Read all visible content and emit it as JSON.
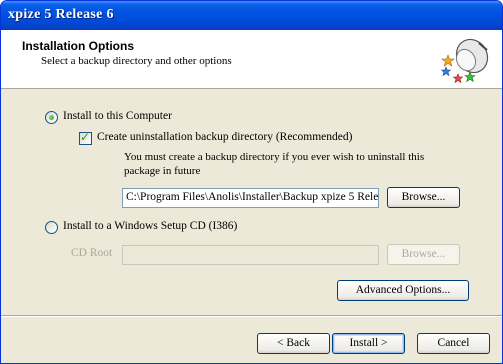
{
  "window": {
    "title": "xpize 5 Release 6"
  },
  "header": {
    "title": "Installation Options",
    "subtitle": "Select a backup directory and other options",
    "icon": "installer-disk-stars-icon"
  },
  "options": {
    "install_computer_label": "Install to this Computer",
    "install_computer_selected": true,
    "backup_checkbox_label": "Create uninstallation backup directory (Recommended)",
    "backup_checkbox_checked": true,
    "backup_note_line1": "You must create a backup directory if you ever wish to uninstall this",
    "backup_note_line2": "package in future",
    "backup_path": "C:\\Program Files\\Anolis\\Installer\\Backup xpize 5 Rele",
    "browse_label": "Browse...",
    "install_cd_label": "Install to a Windows Setup CD (I386)",
    "install_cd_selected": false,
    "cd_root_label": "CD Root",
    "cd_root_value": "",
    "cd_browse_label": "Browse...",
    "advanced_label": "Advanced Options..."
  },
  "footer": {
    "back_label": "< Back",
    "install_label": "Install >",
    "cancel_label": "Cancel"
  }
}
